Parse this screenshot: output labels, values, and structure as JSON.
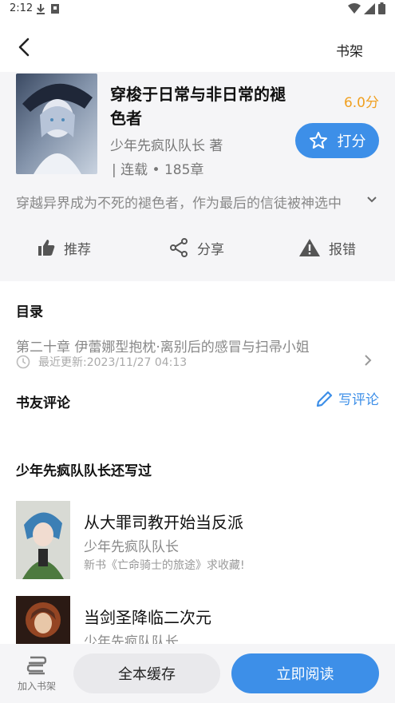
{
  "status_bar": {
    "time": "2:12"
  },
  "app_bar": {
    "shelf_label": "书架"
  },
  "book": {
    "title": "穿梭于日常与非日常的褪色者",
    "rating": "6.0分",
    "author": "少年先疯队队长 著",
    "status": "| 连载 • 185章",
    "rate_label": "打分",
    "summary": "穿越异界成为不死的褪色者，作为最后的信徒被神选中"
  },
  "actions": {
    "recommend": "推荐",
    "share": "分享",
    "report": "报错"
  },
  "toc": {
    "title": "目录",
    "latest_chapter": "第二十章 伊蕾娜型抱枕·离别后的感冒与扫帚小姐",
    "updated": "最近更新:2023/11/27 04:13"
  },
  "reviews": {
    "title": "书友评论",
    "write_label": "写评论"
  },
  "author_works": {
    "title": "少年先疯队队长还写过",
    "books": [
      {
        "title": "从大罪司教开始当反派",
        "author": "少年先疯队队长",
        "desc": "新书《亡命骑士的旅途》求收藏!"
      },
      {
        "title": "当剑圣降临二次元",
        "author": "少年先疯队队长",
        "desc": ""
      }
    ]
  },
  "bottom_bar": {
    "add_shelf": "加入书架",
    "cache_all": "全本缓存",
    "read_now": "立即阅读"
  },
  "colors": {
    "accent": "#3d8fe8",
    "rating": "#f0a020"
  }
}
